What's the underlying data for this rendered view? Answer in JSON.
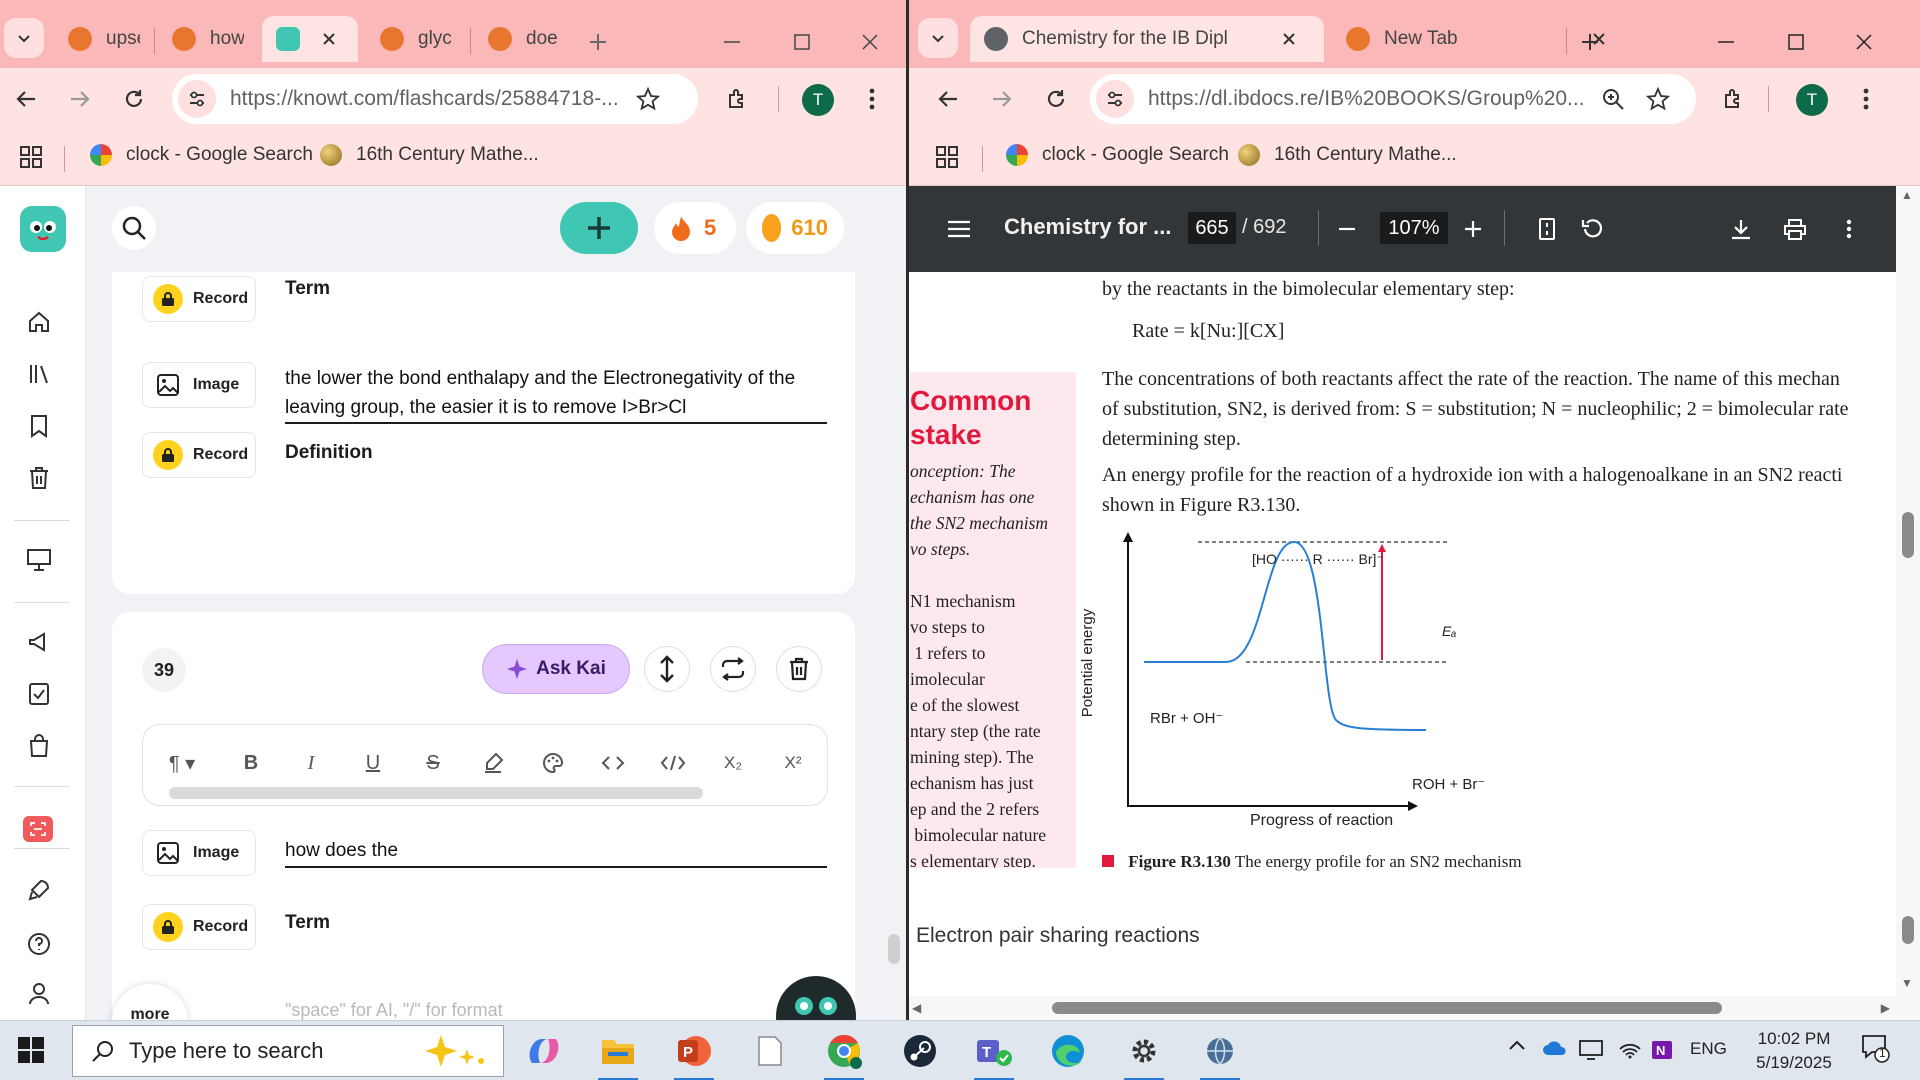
{
  "colors": {
    "chrome_frame": "#fbb8b8",
    "chrome_toolbar": "#ffe3e3",
    "knowt_accent": "#3fc7b4",
    "ask_kai_bg": "#e4c8ff",
    "lock_yellow": "#ffd21f",
    "pdf_toolbar": "#323639",
    "mistake_red": "#e2183d",
    "mistake_bg": "#fde8ee",
    "curve_blue": "#2a7fd4"
  },
  "left_window": {
    "tabs": [
      {
        "title": "upse",
        "icon": "duckduckgo-icon"
      },
      {
        "title": "how",
        "icon": "duckduckgo-icon"
      },
      {
        "title": "",
        "icon": "knowt-icon",
        "active": true
      },
      {
        "title": "glyc",
        "icon": "duckduckgo-icon"
      },
      {
        "title": "doe",
        "icon": "duckduckgo-icon"
      }
    ],
    "url": "https://knowt.com/flashcards/25884718-...",
    "avatar": "T",
    "bookmarks": [
      {
        "label": "clock - Google Search",
        "icon": "google-icon"
      },
      {
        "label": "16th Century Mathe...",
        "icon": "globe-icon"
      }
    ]
  },
  "knowt": {
    "streak": "5",
    "coins": "610",
    "card_top": {
      "row1_btn": "Record",
      "row1_label": "Term",
      "row2_btn": "Image",
      "row2_text": "the lower the bond enthalapy and the Electronegativity of the leaving group, the easier it is to remove I>Br>Cl",
      "row3_btn": "Record",
      "row3_label": "Definition"
    },
    "card_39": {
      "number": "39",
      "ask_kai": "Ask Kai",
      "toolbar": [
        "¶ ▾",
        "B",
        "I",
        "U",
        "S",
        "highlight",
        "palette",
        "<>",
        "</>",
        "X₂",
        "X²"
      ],
      "row1_btn": "Image",
      "row1_text": "how does the",
      "row2_btn": "Record",
      "row2_label": "Term",
      "placeholder": "\"space\" for AI, \"/\" for format",
      "more": "more"
    }
  },
  "right_window": {
    "tabs": [
      {
        "title": "Chemistry for the IB Dipl",
        "icon": "globe-icon",
        "active": true
      },
      {
        "title": "New Tab",
        "icon": "duckduckgo-icon"
      }
    ],
    "url": "https://dl.ibdocs.re/IB%20BOOKS/Group%20...",
    "avatar": "T",
    "bookmarks": [
      {
        "label": "clock - Google Search",
        "icon": "google-icon"
      },
      {
        "label": "16th Century Mathe...",
        "icon": "globe-icon"
      }
    ]
  },
  "pdf": {
    "title": "Chemistry for ...",
    "page": "665",
    "total": "/ 692",
    "zoom": "107%",
    "lines": {
      "l1": "by the reactants in the bimolecular elementary step:",
      "rate": "Rate = k[Nu:][CX]",
      "p2a": "The concentrations of both reactants affect the rate of the reaction. The name of this mechan",
      "p2b": "of substitution, SN2, is derived from: S = substitution; N = nucleophilic; 2 = bimolecular rate",
      "p2c": "determining step.",
      "p3a": "An energy profile for the reaction of a hydroxide ion with a halogenoalkane in an SN2 reacti",
      "p3b": "shown in Figure R3.130."
    },
    "mistake_box": {
      "title": "Common\nstake",
      "body": [
        "onception: The",
        "echanism has one",
        "the SN2 mechanism",
        "vo steps.",
        "",
        "N1 mechanism",
        "vo steps to",
        " 1 refers to",
        "imolecular",
        "e of the slowest",
        "ntary step (the rate",
        "mining step). The",
        "echanism has just",
        "ep and the 2 refers",
        " bimolecular nature",
        "s elementary step."
      ]
    },
    "figure": {
      "transition_state": "[HO ······ R ······ Br]⁻",
      "reactants": "RBr + OH⁻",
      "products": "ROH + Br⁻",
      "ea": "Eₐ",
      "ylabel": "Potential energy",
      "xlabel": "Progress of reaction",
      "caption_bold": "Figure R3.130",
      "caption": "The energy profile for an SN2 mechanism"
    },
    "section": "Electron pair sharing reactions"
  },
  "taskbar": {
    "search_placeholder": "Type here to search",
    "lang": "ENG",
    "time": "10:02 PM",
    "date": "5/19/2025",
    "notifications": "1"
  }
}
